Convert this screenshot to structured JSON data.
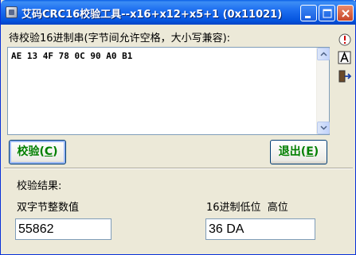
{
  "window": {
    "title": "艾码CRC16校验工具--x16+x12+x5+1 (0x11021)",
    "controls": {
      "minimize": "_",
      "maximize": "□",
      "close": "×"
    }
  },
  "input": {
    "label": "待校验16进制串(字节间允许空格，大小写兼容):",
    "value": "AE 13 4F 78 0C 90 A0 B1"
  },
  "side_tools": [
    "info-icon",
    "font-icon",
    "exit-icon"
  ],
  "buttons": {
    "verify_label": "校验(",
    "verify_accel": "C",
    "verify_tail": ")",
    "exit_label": "退出(",
    "exit_accel": "E",
    "exit_tail": ")"
  },
  "results": {
    "section_label": "校验结果:",
    "int_label": "双字节整数值",
    "int_value": "55862",
    "hex_label": "16进制低位  高位",
    "hex_value": "36 DA"
  },
  "colors": {
    "title_bar": "#0a5fe6",
    "button_text": "#007f00",
    "window_bg": "#ece9d8"
  }
}
